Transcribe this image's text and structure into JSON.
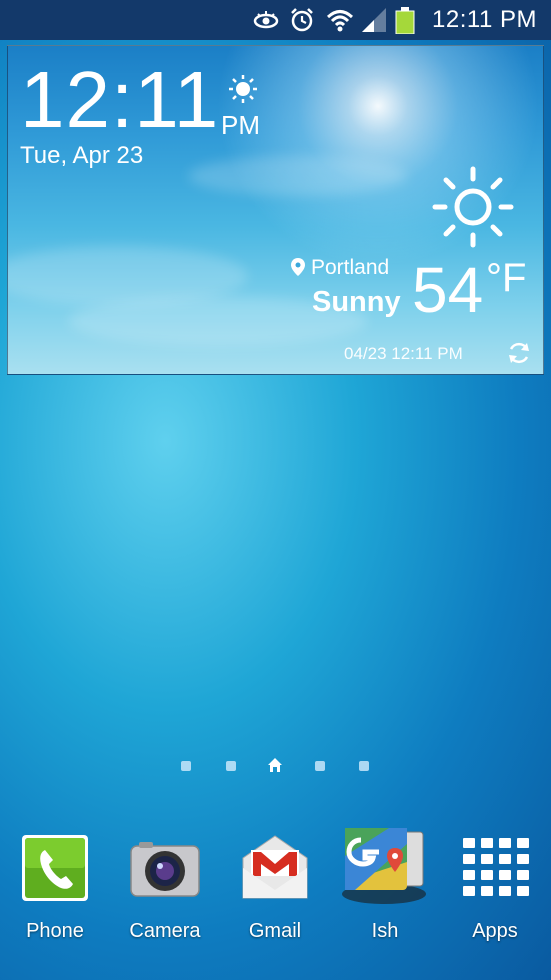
{
  "status_bar": {
    "time": "12:11 PM",
    "icons": [
      "eye-icon",
      "alarm-clock-icon",
      "wifi-icon",
      "signal-icon",
      "battery-icon"
    ],
    "battery_color": "#a5d83a"
  },
  "clock_widget": {
    "time": "12:11",
    "ampm": "PM",
    "date": "Tue, Apr 23",
    "alarm_indicator_icon": "sun-alarm-icon"
  },
  "weather_widget": {
    "location": "Portland",
    "condition": "Sunny",
    "temperature": "54",
    "unit": "°F",
    "updated": "04/23 12:11 PM",
    "condition_icon": "sun-icon",
    "refresh_icon": "refresh-icon"
  },
  "page_indicator": {
    "pages": 5,
    "current": 2,
    "home_icon": "home-icon"
  },
  "dock": {
    "apps": [
      {
        "label": "Phone",
        "icon": "phone-icon"
      },
      {
        "label": "Camera",
        "icon": "camera-icon"
      },
      {
        "label": "Gmail",
        "icon": "gmail-icon"
      },
      {
        "label": "Ish",
        "icon": "maps-folder-icon"
      },
      {
        "label": "Apps",
        "icon": "apps-grid-icon"
      }
    ]
  }
}
